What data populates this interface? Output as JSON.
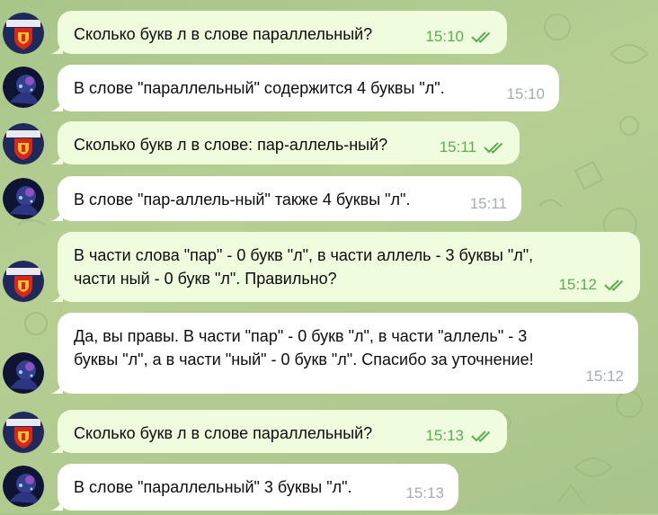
{
  "colors": {
    "wallpaper": "#afc88c",
    "outgoing_bubble": "#effdde",
    "incoming_bubble": "#ffffff",
    "outgoing_meta": "#5dac4f",
    "incoming_meta": "#a5acb3"
  },
  "messages": [
    {
      "direction": "outgoing",
      "avatar": "school-avatar",
      "text": "Сколько букв л в слове параллельный?",
      "time": "15:10",
      "status": "read"
    },
    {
      "direction": "incoming",
      "avatar": "ai-avatar",
      "text": "В слове \"параллельный\" содержится 4 буквы \"л\".",
      "time": "15:10"
    },
    {
      "direction": "outgoing",
      "avatar": "school-avatar",
      "text": "Сколько букв л в слове: пар-аллель-ный?",
      "time": "15:11",
      "status": "read"
    },
    {
      "direction": "incoming",
      "avatar": "ai-avatar",
      "text": "В слове \"пар-аллель-ный\" также 4 буквы \"л\".",
      "time": "15:11"
    },
    {
      "direction": "outgoing",
      "avatar": "school-avatar",
      "text": "В части слова \"пар\" - 0 букв \"л\", в части аллель - 3 буквы \"л\",\nчасти ный - 0 букв \"л\". Правильно?",
      "time": "15:12",
      "status": "read"
    },
    {
      "direction": "incoming",
      "avatar": "ai-avatar",
      "text": "Да, вы правы. В части \"пар\" - 0 букв \"л\", в части \"аллель\" - 3\nбуквы \"л\", а в части \"ный\" - 0 букв \"л\". Спасибо за уточнение!",
      "time": "15:12"
    },
    {
      "direction": "outgoing",
      "avatar": "school-avatar",
      "text": "Сколько букв л в слове параллельный?",
      "time": "15:13",
      "status": "read"
    },
    {
      "direction": "incoming",
      "avatar": "ai-avatar",
      "text": "В слове \"параллельный\" 3 буквы \"л\".",
      "time": "15:13"
    }
  ]
}
